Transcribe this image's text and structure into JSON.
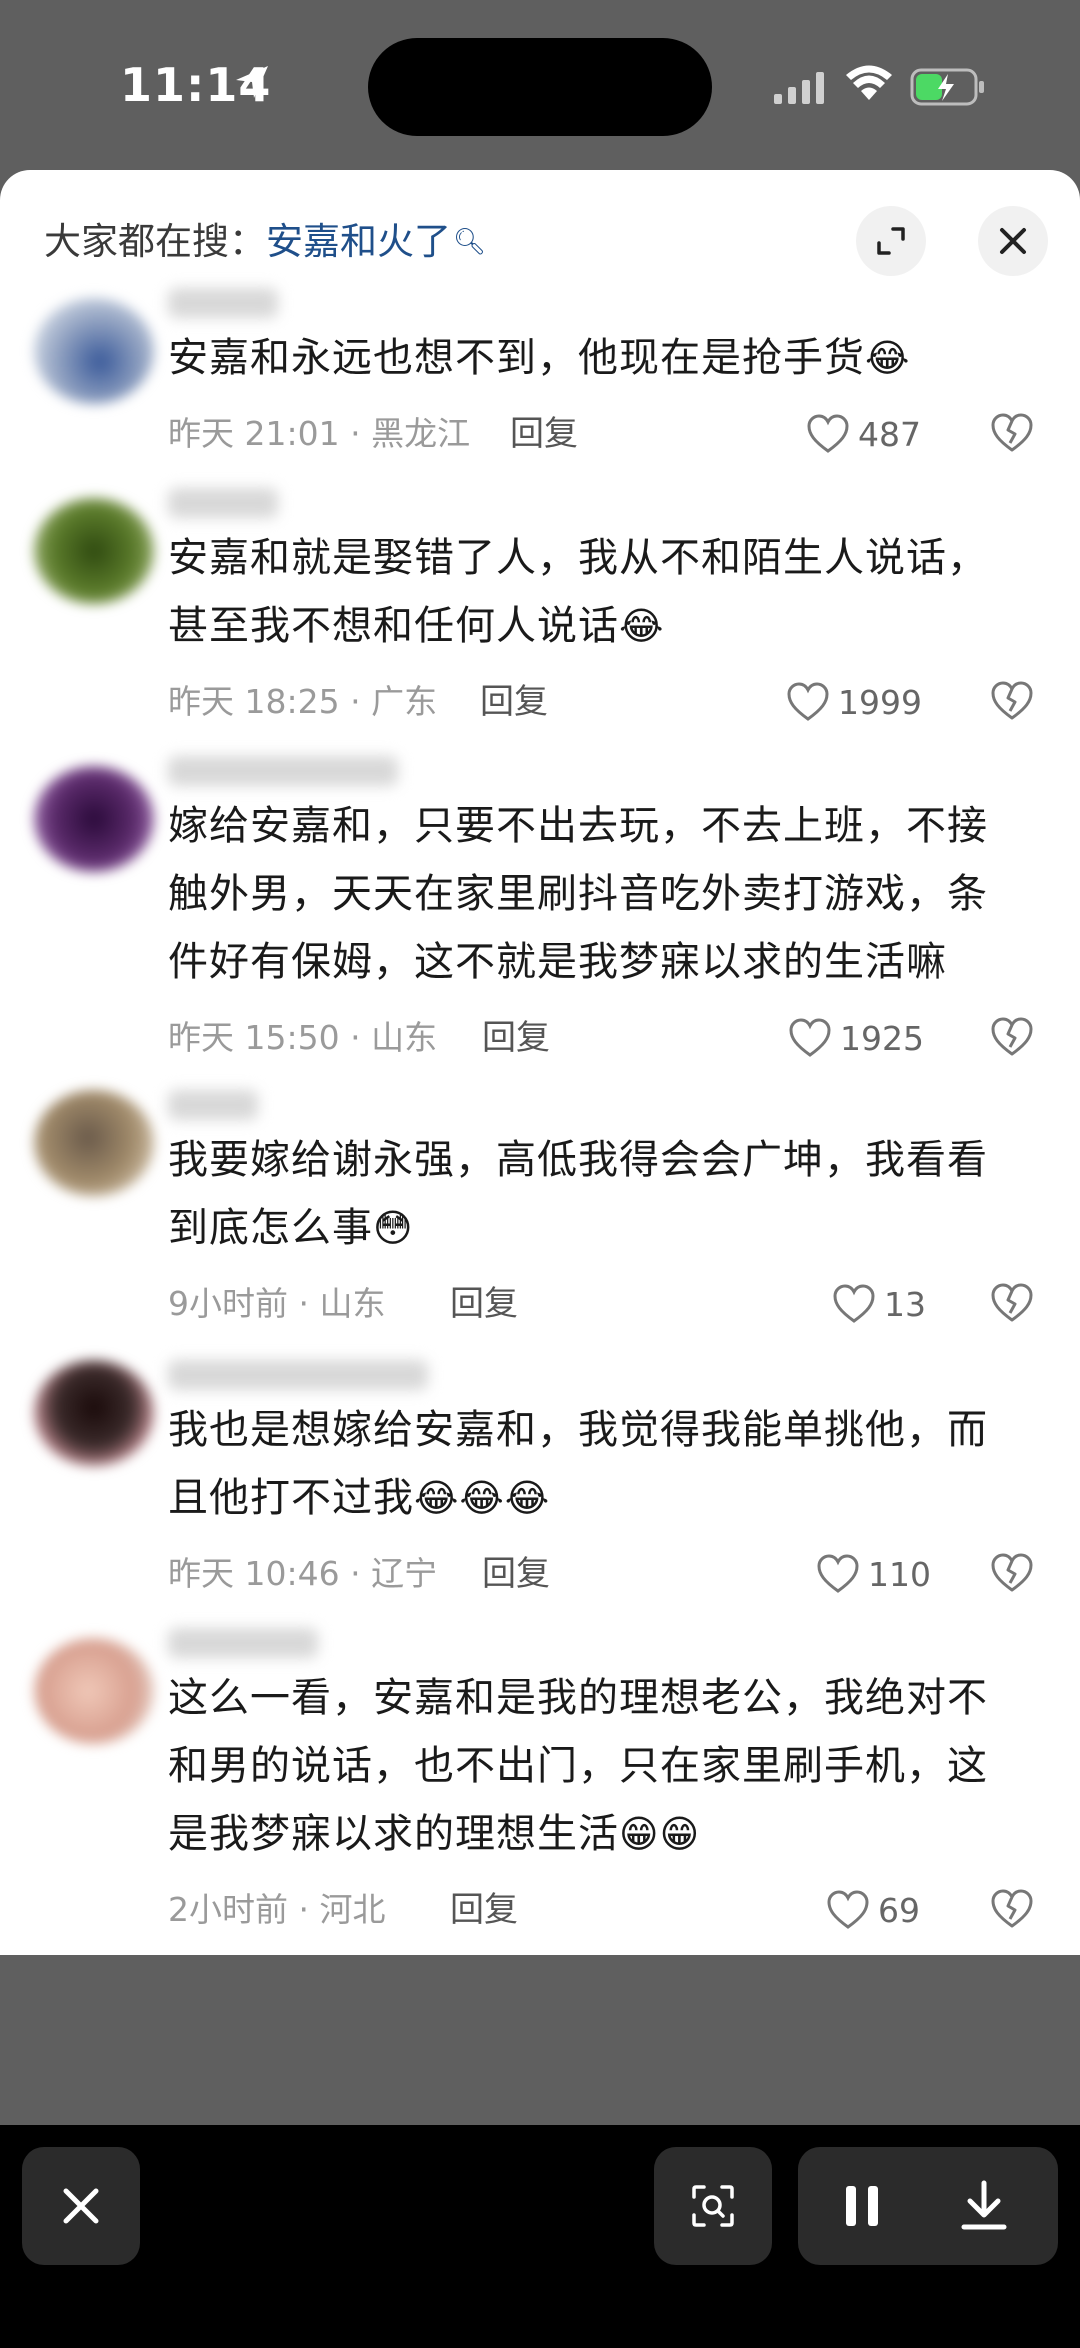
{
  "status_bar": {
    "time": "11:14"
  },
  "search": {
    "prefix": "大家都在搜：",
    "term": "安嘉和火了",
    "search_glyph": "🔍︎"
  },
  "comments": [
    {
      "text": "安嘉和永远也想不到，他现在是抢手货",
      "emojis": "😂",
      "time": "昨天 21:01",
      "location": "黑龙江",
      "reply_label": "回复",
      "likes": "487",
      "avatar_color": "#8fa0c0"
    },
    {
      "text": "安嘉和就是娶错了人，我从不和陌生人说话，甚至我不想和任何人说话",
      "emojis": "😂",
      "time": "昨天 18:25",
      "location": "广东",
      "reply_label": "回复",
      "likes": "1999",
      "avatar_color": "#5a7a2a"
    },
    {
      "text": "嫁给安嘉和，只要不出去玩，不去上班，不接触外男，天天在家里刷抖音吃外卖打游戏，条件好有保姆，这不就是我梦寐以求的生活嘛",
      "emojis": "",
      "time": "昨天 15:50",
      "location": "山东",
      "reply_label": "回复",
      "likes": "1925",
      "avatar_color": "#5a2a6a"
    },
    {
      "text": "我要嫁给谢永强，高低我得会会广坤，我看看到底怎么事",
      "emojis": "😳",
      "time": "9小时前",
      "location": "山东",
      "reply_label": "回复",
      "likes": "13",
      "avatar_color": "#a08a6a"
    },
    {
      "text": "我也是想嫁给安嘉和，我觉得我能单挑他，而且他打不过我",
      "emojis": "😂😂😂",
      "time": "昨天 10:46",
      "location": "辽宁",
      "reply_label": "回复",
      "likes": "110",
      "avatar_color": "#3a2a2a"
    },
    {
      "text": "这么一看，安嘉和是我的理想老公，我绝对不和男的说话，也不出门，只在家里刷手机，这是我梦寐以求的理想生活",
      "emojis": "😁😁",
      "time": "2小时前",
      "location": "河北",
      "reply_label": "回复",
      "likes": "69",
      "avatar_color": "#d8a090"
    }
  ],
  "bottom_bar": {
    "close_icon": "close-icon",
    "scan_icon": "scan-icon",
    "pause_icon": "pause-icon",
    "download_icon": "download-icon"
  }
}
